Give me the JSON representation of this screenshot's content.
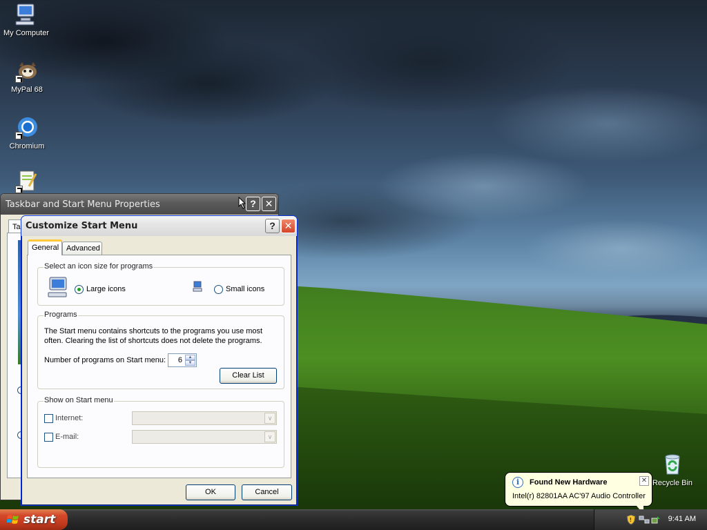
{
  "desktop": {
    "icons": [
      {
        "label": "My Computer",
        "icon": "computer-icon"
      },
      {
        "label": "MyPal 68",
        "icon": "mypal-browser-icon"
      },
      {
        "label": "Chromium",
        "icon": "chromium-icon"
      },
      {
        "label": "",
        "icon": "notepad-plus-plus-icon"
      },
      {
        "label": "Recycle Bin",
        "icon": "recycle-bin-icon"
      }
    ]
  },
  "taskbar_props": {
    "title": "Taskbar and Start Menu Properties",
    "tab_partial": "Ta"
  },
  "customize": {
    "title": "Customize Start Menu",
    "tabs": {
      "general": "General",
      "advanced": "Advanced"
    },
    "icon_size": {
      "group": "Select an icon size for programs",
      "large": "Large icons",
      "small": "Small icons",
      "selected": "large"
    },
    "programs": {
      "group": "Programs",
      "description": "The Start menu contains shortcuts to the programs you use most often. Clearing the list of shortcuts does not delete the programs.",
      "count_label": "Number of programs on Start menu:",
      "count_value": "6",
      "clear_button": "Clear List"
    },
    "show": {
      "group": "Show on Start menu",
      "internet": "Internet:",
      "email": "E-mail:"
    },
    "ok": "OK",
    "cancel": "Cancel"
  },
  "balloon": {
    "title": "Found New Hardware",
    "message": "Intel(r) 82801AA AC'97 Audio Controller"
  },
  "taskbar": {
    "start": "start",
    "clock": "9:41 AM"
  }
}
